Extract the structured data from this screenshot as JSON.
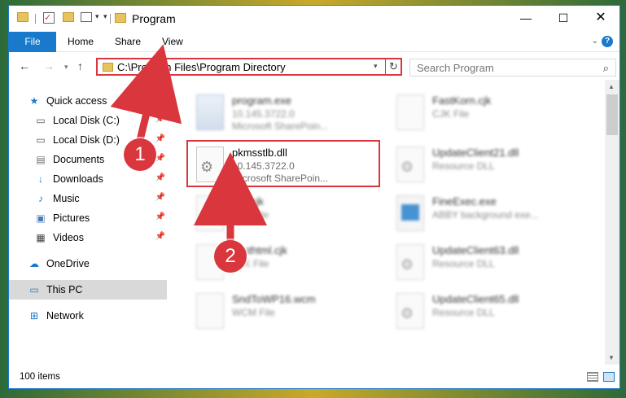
{
  "window": {
    "title": "Program",
    "min_glyph": "—",
    "max_glyph": "☐",
    "close_glyph": "✕"
  },
  "quick_access_toolbar": {
    "check_glyph": "✓",
    "arrow_glyph": "▾",
    "customize_glyph": "▾"
  },
  "ribbon": {
    "file": "File",
    "home": "Home",
    "share": "Share",
    "view": "View",
    "chevron_glyph": "⌄",
    "help_glyph": "?"
  },
  "navbar": {
    "back_glyph": "←",
    "forward_glyph": "→",
    "recent_glyph": "▾",
    "up_glyph": "↑",
    "address": "C:\\Program Files\\Program Directory",
    "address_drop_glyph": "▾",
    "refresh_glyph": "↻",
    "search_placeholder": "Search Program",
    "search_glyph": "⌕"
  },
  "sidebar": {
    "pin_glyph": "📌",
    "items": [
      {
        "label": "Quick access",
        "icon": "star-icon",
        "glyph": "★",
        "color": "#1979ca",
        "pinned": false
      },
      {
        "label": "Local Disk (C:)",
        "icon": "drive-icon",
        "glyph": "▭",
        "color": "#555555",
        "pinned": true
      },
      {
        "label": "Local Disk (D:)",
        "icon": "drive-icon",
        "glyph": "▭",
        "color": "#555555",
        "pinned": true
      },
      {
        "label": "Documents",
        "icon": "documents-icon",
        "glyph": "▤",
        "color": "#6d6d6d",
        "pinned": true
      },
      {
        "label": "Downloads",
        "icon": "download-icon",
        "glyph": "↓",
        "color": "#1979ca",
        "pinned": true
      },
      {
        "label": "Music",
        "icon": "music-icon",
        "glyph": "♪",
        "color": "#1979ca",
        "pinned": true
      },
      {
        "label": "Pictures",
        "icon": "pictures-icon",
        "glyph": "▣",
        "color": "#4a7bb7",
        "pinned": true
      },
      {
        "label": "Videos",
        "icon": "videos-icon",
        "glyph": "▦",
        "color": "#444444",
        "pinned": true
      },
      {
        "label": "OneDrive",
        "icon": "cloud-icon",
        "glyph": "☁",
        "color": "#1979ca",
        "pinned": false
      },
      {
        "label": "This PC",
        "icon": "computer-icon",
        "glyph": "▭",
        "color": "#1979ca",
        "pinned": false
      },
      {
        "label": "Network",
        "icon": "network-icon",
        "glyph": "⊞",
        "color": "#1979ca",
        "pinned": false
      }
    ]
  },
  "files": [
    {
      "name": "program.exe",
      "l2": "10.145.3722.0",
      "l3": "Microsoft SharePoin...",
      "kind": "exe",
      "blurred": true
    },
    {
      "name": "FastKorn.cjk",
      "l2": "CJK File",
      "l3": "",
      "kind": "blank",
      "blurred": true
    },
    {
      "name": "pkmsstlb.dll",
      "l2": "10.145.3722.0",
      "l3": "Microsoft SharePoin...",
      "kind": "dll",
      "blurred": false
    },
    {
      "name": "UpdateClient21.dll",
      "l2": "Resource DLL",
      "l3": "",
      "kind": "dll",
      "blurred": true
    },
    {
      "name": "Std.cjk",
      "l2": "CJK File",
      "l3": "",
      "kind": "blank",
      "blurred": true
    },
    {
      "name": "FineExec.exe",
      "l2": "ABBY background exe...",
      "l3": "",
      "kind": "app",
      "blurred": true
    },
    {
      "name": "Testhtml.cjk",
      "l2": "CJK File",
      "l3": "",
      "kind": "blank",
      "blurred": true
    },
    {
      "name": "UpdateClient63.dll",
      "l2": "Resource DLL",
      "l3": "",
      "kind": "dll",
      "blurred": true
    },
    {
      "name": "SndToWP16.wcm",
      "l2": "WCM File",
      "l3": "",
      "kind": "blank",
      "blurred": true
    },
    {
      "name": "UpdateClient65.dll",
      "l2": "Resource DLL",
      "l3": "",
      "kind": "dll",
      "blurred": true
    }
  ],
  "scrollbar": {
    "up_glyph": "▲",
    "down_glyph": "▼"
  },
  "status": {
    "items": "100 items"
  },
  "annotations": {
    "badge1": "1",
    "badge2": "2",
    "color": "#d9363e"
  }
}
